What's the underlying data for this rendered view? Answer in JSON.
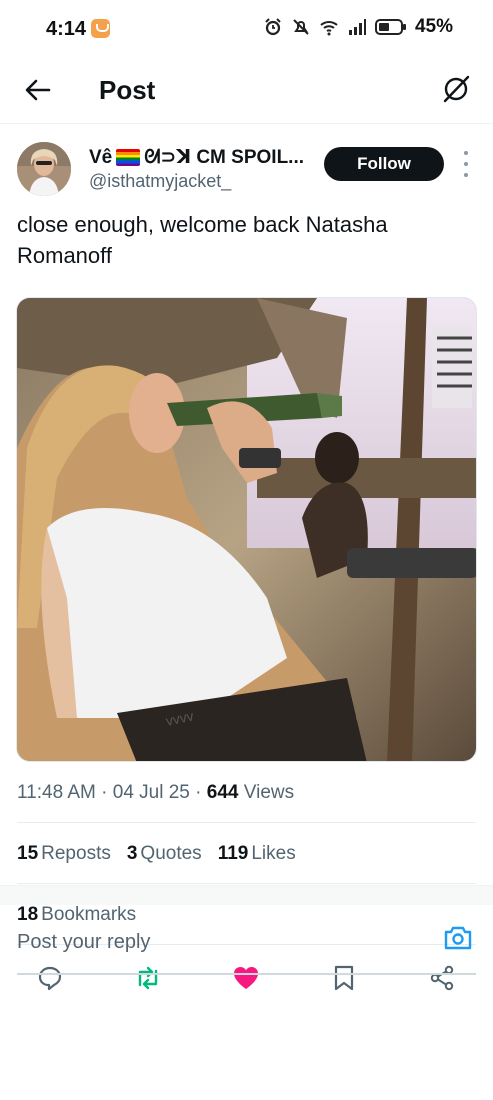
{
  "status_bar": {
    "time": "4:14",
    "battery": "45%",
    "icons": [
      "alarm-icon",
      "mute-icon",
      "wifi-icon",
      "signal-icon",
      "battery-icon"
    ]
  },
  "app_bar": {
    "title": "Post",
    "back_icon": "arrow-left-icon",
    "grok_icon": "grok-icon"
  },
  "post": {
    "author_name": "Vê",
    "author_name_suffix": "ᘛ⊃ꓘ CM SPOIL...",
    "handle": "@isthatmyjacket_",
    "follow_label": "Follow",
    "text": "close enough, welcome back Natasha Romanoff",
    "media_alt": "Photo",
    "time": "11:48 AM",
    "date": "04 Jul 25",
    "views_count": "644",
    "views_label": "Views"
  },
  "stats": {
    "reposts_count": "15",
    "reposts_label": "Reposts",
    "quotes_count": "3",
    "quotes_label": "Quotes",
    "likes_count": "119",
    "likes_label": "Likes",
    "bookmarks_count": "18",
    "bookmarks_label": "Bookmarks"
  },
  "actions": [
    "reply-icon",
    "repost-icon",
    "like-icon",
    "bookmark-icon",
    "share-icon"
  ],
  "colors": {
    "repost_active": "#00ba7c",
    "like_active": "#f91880",
    "accent": "#1d9bf0",
    "text_secondary": "#536471"
  },
  "reply": {
    "placeholder": "Post your reply"
  }
}
